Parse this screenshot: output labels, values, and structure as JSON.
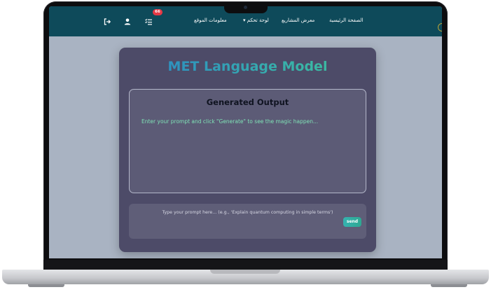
{
  "navbar": {
    "links": {
      "home": "الصفحة الرئيسية",
      "projects": "معرض المشاريع",
      "dashboard": "لوحة تحكم ▾",
      "site_info": "معلومات الموقع"
    },
    "badge_count": "66",
    "icons": [
      "logout-icon",
      "user-icon",
      "tasks-icon"
    ]
  },
  "card": {
    "title": "MET Language Model",
    "output": {
      "heading": "Generated Output",
      "text": "Enter your prompt and click \"Generate\" to see the magic happen..."
    },
    "prompt": {
      "placeholder": "Type your prompt here... (e.g., 'Explain quantum computing in simple terms')",
      "value": ""
    },
    "send_label": "send"
  },
  "colors": {
    "navbar": "#0e4a5a",
    "page_bg": "#a9b3c2",
    "card_bg": "#4d4b68",
    "title_gradient_start": "#2a86c8",
    "title_gradient_end": "#3fc79a",
    "output_text": "#7fe3b6",
    "badge": "#e53945",
    "send_button": "#35b3b0"
  }
}
